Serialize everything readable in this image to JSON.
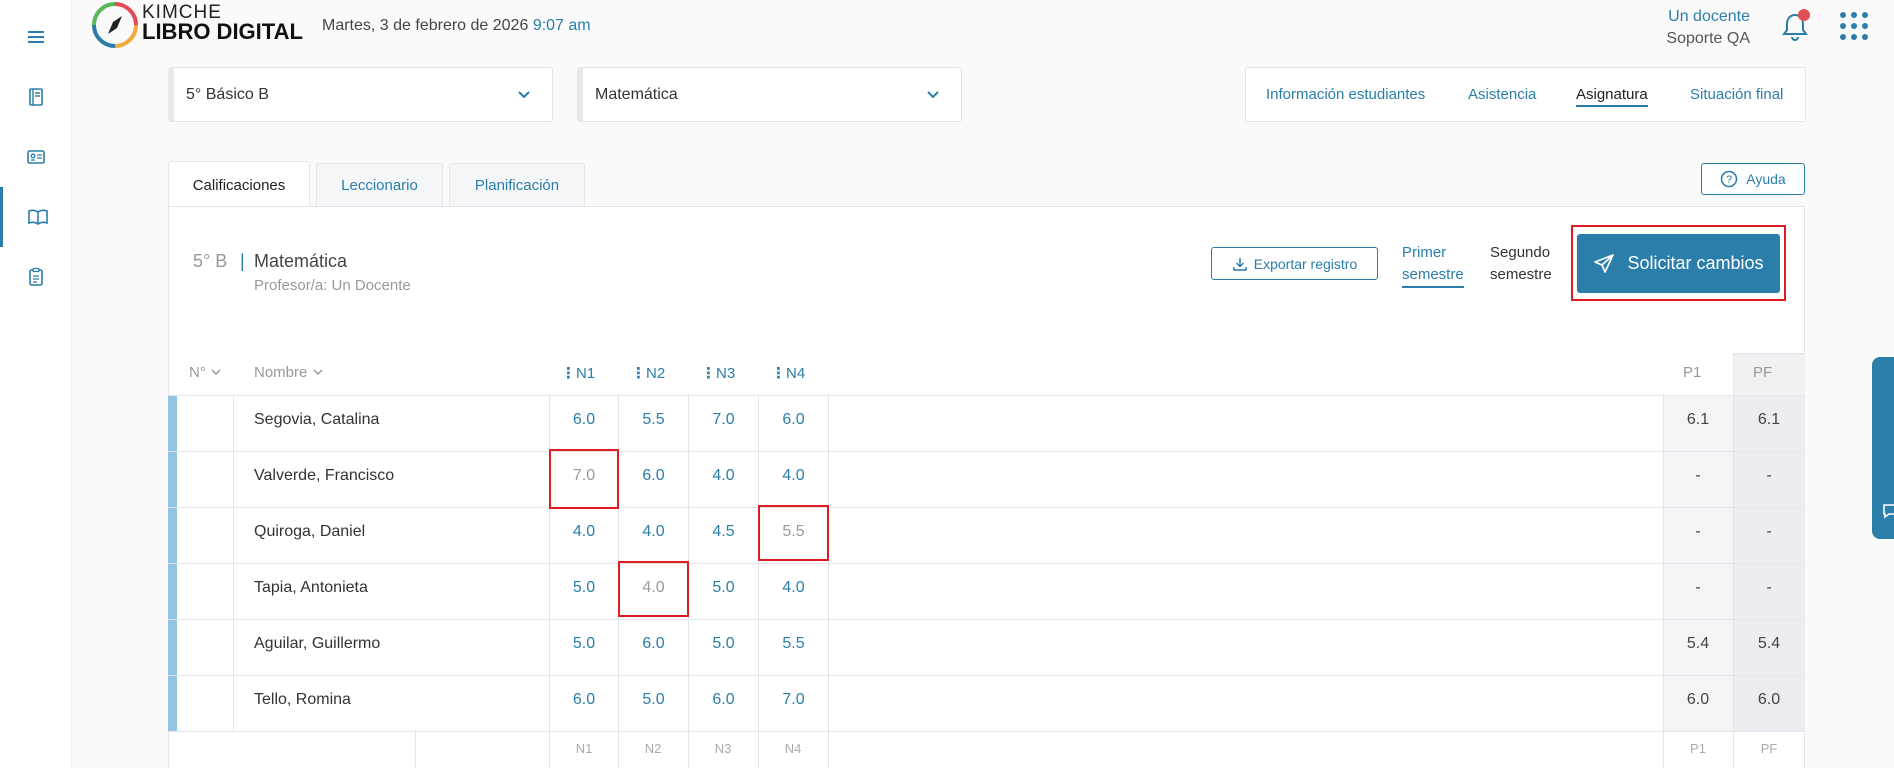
{
  "header": {
    "logo_top": "KIMCHE",
    "logo_bottom": "LIBRO DIGITAL",
    "date": "Martes, 3 de febrero de 2026",
    "time": "9:07 am",
    "user_name": "Un docente",
    "user_role": "Soporte QA"
  },
  "selectors": {
    "course": "5° Básico B",
    "subject": "Matemática"
  },
  "nav_tabs": [
    "Información estudiantes",
    "Asistencia",
    "Asignatura",
    "Situación final"
  ],
  "nav_active": "Asignatura",
  "tabs": [
    "Calificaciones",
    "Leccionario",
    "Planificación"
  ],
  "help_label": "Ayuda",
  "course_info": {
    "name": "5° B",
    "separator": "|",
    "subject": "Matemática",
    "professor": "Profesor/a: Un Docente"
  },
  "actions": {
    "export_label": "Exportar registro",
    "semester1_line1": "Primer",
    "semester1_line2": "semestre",
    "semester2_line1": "Segundo",
    "semester2_line2": "semestre",
    "request_label": "Solicitar cambios"
  },
  "table": {
    "col_num": "N°",
    "col_name": "Nombre",
    "grade_cols": [
      "N1",
      "N2",
      "N3",
      "N4"
    ],
    "p1": "P1",
    "pf": "PF",
    "rows": [
      {
        "name": "Segovia, Catalina",
        "grades": [
          "6.0",
          "5.5",
          "7.0",
          "6.0"
        ],
        "p1": "6.1",
        "pf": "6.1"
      },
      {
        "name": "Valverde, Francisco",
        "grades": [
          "7.0",
          "6.0",
          "4.0",
          "4.0"
        ],
        "p1": "-",
        "pf": "-"
      },
      {
        "name": "Quiroga, Daniel",
        "grades": [
          "4.0",
          "4.0",
          "4.5",
          "5.5"
        ],
        "p1": "-",
        "pf": "-"
      },
      {
        "name": "Tapia, Antonieta",
        "grades": [
          "5.0",
          "4.0",
          "5.0",
          "4.0"
        ],
        "p1": "-",
        "pf": "-"
      },
      {
        "name": "Aguilar, Guillermo",
        "grades": [
          "5.0",
          "6.0",
          "5.0",
          "5.5"
        ],
        "p1": "5.4",
        "pf": "5.4"
      },
      {
        "name": "Tello, Romina",
        "grades": [
          "6.0",
          "5.0",
          "6.0",
          "7.0"
        ],
        "p1": "6.0",
        "pf": "6.0"
      }
    ]
  },
  "colors": {
    "accent": "#2b7ea9",
    "highlight": "#e01b24",
    "muted_grade": "#9a9a9a",
    "row_bar": "#93c4e1"
  }
}
